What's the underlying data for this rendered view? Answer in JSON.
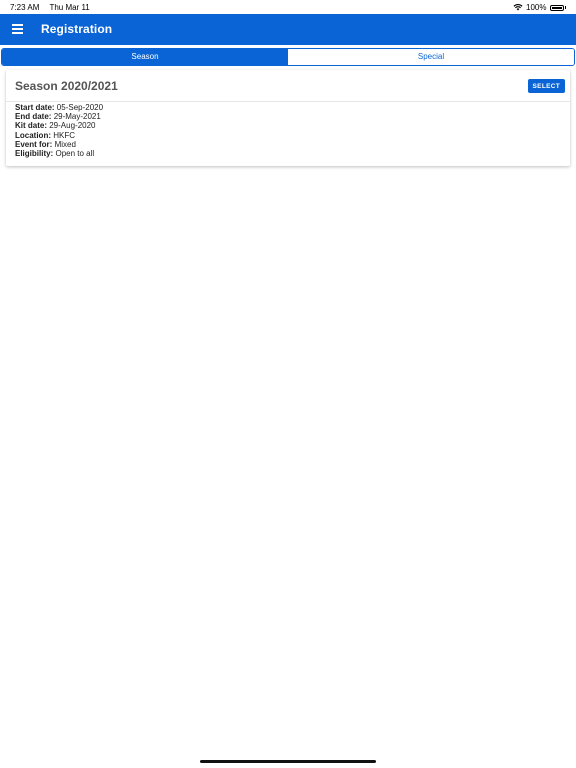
{
  "status": {
    "time": "7:23 AM",
    "date": "Thu Mar 11",
    "battery": "100%"
  },
  "app_bar": {
    "title": "Registration",
    "icon": "hamburger-menu-icon"
  },
  "tabs": [
    {
      "label": "Season",
      "active": true
    },
    {
      "label": "Special",
      "active": false
    }
  ],
  "card": {
    "title": "Season 2020/2021",
    "select_label": "SELECT",
    "details": [
      {
        "label": "Start date:",
        "value": "05-Sep-2020"
      },
      {
        "label": "End date:",
        "value": "29-May-2021"
      },
      {
        "label": "Kit date:",
        "value": "29-Aug-2020"
      },
      {
        "label": "Location:",
        "value": "HKFC"
      },
      {
        "label": "Event for:",
        "value": "Mixed"
      },
      {
        "label": "Eligibility:",
        "value": "Open to all"
      }
    ]
  },
  "colors": {
    "primary": "#0a64d6"
  }
}
